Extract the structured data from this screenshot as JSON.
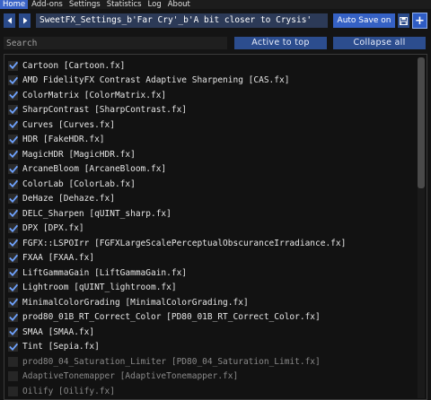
{
  "menubar": {
    "items": [
      {
        "label": "Home",
        "active": true
      },
      {
        "label": "Add-ons",
        "active": false
      },
      {
        "label": "Settings",
        "active": false
      },
      {
        "label": "Statistics",
        "active": false
      },
      {
        "label": "Log",
        "active": false
      },
      {
        "label": "About",
        "active": false
      }
    ]
  },
  "preset": {
    "prev_icon": "triangle-left-icon",
    "next_icon": "triangle-right-icon",
    "path": "SweetFX_Settings_b'Far Cry'_b'A bit closer to Crysis'",
    "auto_save_label": "Auto Save on",
    "save_icon": "floppy-disk-icon",
    "add_label": "+"
  },
  "controls": {
    "search_placeholder": "Search",
    "active_to_top_label": "Active to top",
    "collapse_all_label": "Collapse all"
  },
  "effects": [
    {
      "label": "Cartoon [Cartoon.fx]",
      "enabled": true
    },
    {
      "label": "AMD FidelityFX Contrast Adaptive Sharpening [CAS.fx]",
      "enabled": true
    },
    {
      "label": "ColorMatrix [ColorMatrix.fx]",
      "enabled": true
    },
    {
      "label": "SharpContrast [SharpContrast.fx]",
      "enabled": true
    },
    {
      "label": "Curves [Curves.fx]",
      "enabled": true
    },
    {
      "label": "HDR [FakeHDR.fx]",
      "enabled": true
    },
    {
      "label": "MagicHDR [MagicHDR.fx]",
      "enabled": true
    },
    {
      "label": "ArcaneBloom [ArcaneBloom.fx]",
      "enabled": true
    },
    {
      "label": "ColorLab [ColorLab.fx]",
      "enabled": true
    },
    {
      "label": "DeHaze [Dehaze.fx]",
      "enabled": true
    },
    {
      "label": "DELC_Sharpen [qUINT_sharp.fx]",
      "enabled": true
    },
    {
      "label": "DPX [DPX.fx]",
      "enabled": true
    },
    {
      "label": "FGFX::LSPOIrr [FGFXLargeScalePerceptualObscuranceIrradiance.fx]",
      "enabled": true
    },
    {
      "label": "FXAA [FXAA.fx]",
      "enabled": true
    },
    {
      "label": "LiftGammaGain [LiftGammaGain.fx]",
      "enabled": true
    },
    {
      "label": "Lightroom [qUINT_lightroom.fx]",
      "enabled": true
    },
    {
      "label": "MinimalColorGrading [MinimalColorGrading.fx]",
      "enabled": true
    },
    {
      "label": "prod80_01B_RT_Correct_Color [PD80_01B_RT_Correct_Color.fx]",
      "enabled": true
    },
    {
      "label": "SMAA [SMAA.fx]",
      "enabled": true
    },
    {
      "label": "Tint [Sepia.fx]",
      "enabled": true
    },
    {
      "label": "prod80_04_Saturation_Limiter [PD80_04_Saturation_Limit.fx]",
      "enabled": false
    },
    {
      "label": "AdaptiveTonemapper [AdaptiveTonemapper.fx]",
      "enabled": false
    },
    {
      "label": "Oilify [Oilify.fx]",
      "enabled": false
    }
  ],
  "colors": {
    "accent": "#3a63c7",
    "check": "#6fa3ff",
    "background": "#141414"
  }
}
